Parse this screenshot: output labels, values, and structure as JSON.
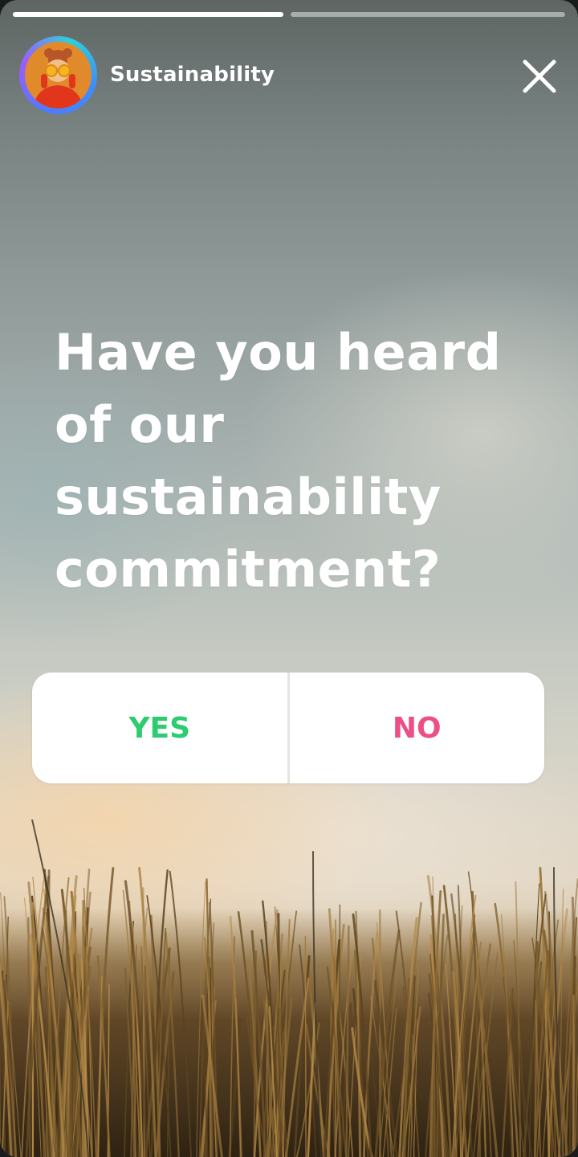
{
  "story": {
    "progress": [
      {
        "filled": 1.0
      },
      {
        "filled": 0.0
      }
    ],
    "account": {
      "name": "Sustainability"
    },
    "close_icon": "close-icon",
    "question": [
      "Have you heard",
      "of our",
      "sustainability",
      "commitment?"
    ],
    "poll": {
      "options": [
        {
          "label": "YES",
          "color": "#2ecc71"
        },
        {
          "label": "NO",
          "color": "#ec4f86"
        }
      ]
    }
  },
  "colors": {
    "text": "#ffffff",
    "poll_background": "#ffffff",
    "yes": "#2ecc71",
    "no": "#ec4f86"
  }
}
